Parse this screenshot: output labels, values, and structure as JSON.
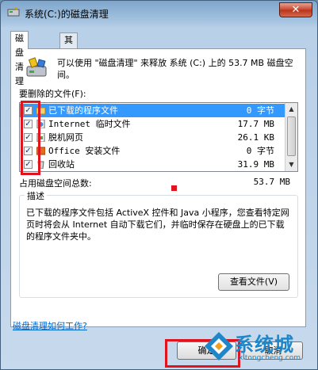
{
  "window": {
    "title": "系统(C:)的磁盘清理",
    "close_label": "✕"
  },
  "tabs": [
    {
      "label": "磁盘清理",
      "active": true
    },
    {
      "label": "其他选项",
      "active": false
    }
  ],
  "header": {
    "text": "可以使用 \"磁盘清理\" 来释放 系统 (C:) 上的 53.7 MB 磁盘空间。"
  },
  "files_section": {
    "label": "要删除的文件(F):",
    "items": [
      {
        "name": "已下载的程序文件",
        "size": "0 字节",
        "checked": true,
        "selected": true,
        "icon": "folder-icon"
      },
      {
        "name": "Internet 临时文件",
        "size": "17.7 MB",
        "checked": true,
        "selected": false,
        "icon": "internet-page-icon"
      },
      {
        "name": "脱机网页",
        "size": "26.1 KB",
        "checked": true,
        "selected": false,
        "icon": "offline-page-icon"
      },
      {
        "name": "Office 安装文件",
        "size": "0 字节",
        "checked": true,
        "selected": false,
        "icon": "office-icon"
      },
      {
        "name": "回收站",
        "size": "31.9 MB",
        "checked": true,
        "selected": false,
        "icon": "recycle-bin-icon"
      }
    ]
  },
  "total": {
    "label": "占用磁盘空间总数:",
    "value": "53.7 MB"
  },
  "description": {
    "legend": "描述",
    "text": "已下载的程序文件包括 ActiveX 控件和 Java 小程序，您查看特定网页时将会从 Internet 自动下载它们，并临时保存在硬盘上的已下载的程序文件夹中。",
    "view_files_label": "查看文件(V)"
  },
  "help_link": "磁盘清理如何工作?",
  "buttons": {
    "ok": "确定",
    "cancel": "取消"
  },
  "watermark": {
    "brand": "系统城",
    "url": "xitongcheng.com"
  },
  "colors": {
    "selection": "#3399ff",
    "highlight": "#e0141c",
    "link": "#0066cc"
  }
}
